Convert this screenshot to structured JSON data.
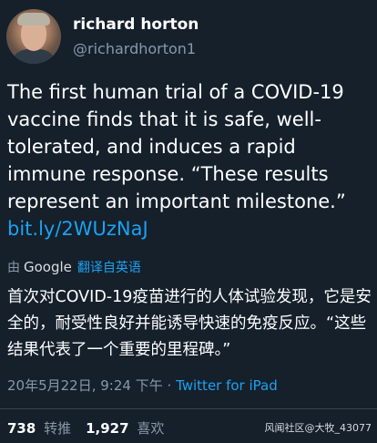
{
  "user": {
    "display_name": "richard horton",
    "handle": "@richardhorton1"
  },
  "tweet": {
    "text": "The first human trial of a COVID-19 vaccine finds that it is safe, well-tolerated, and induces a rapid immune response. “These results represent an important milestone.”",
    "link": "bit.ly/2WUzNaJ"
  },
  "translation": {
    "by": "由",
    "provider": "Google",
    "action": "翻译自英语",
    "text": "首次对COVID-19疫苗进行的人体试验发现，它是安全的，耐受性良好并能诱导快速的免疫反应。“这些结果代表了一个重要的里程碑。”"
  },
  "meta": {
    "timestamp": "20年5月22日, 9:24 下午",
    "separator": "·",
    "source": "Twitter for iPad"
  },
  "stats": {
    "retweets_count": "738",
    "retweets_label": "转推",
    "likes_count": "1,927",
    "likes_label": "喜欢"
  },
  "watermark": "风闻社区@大牧_43077"
}
